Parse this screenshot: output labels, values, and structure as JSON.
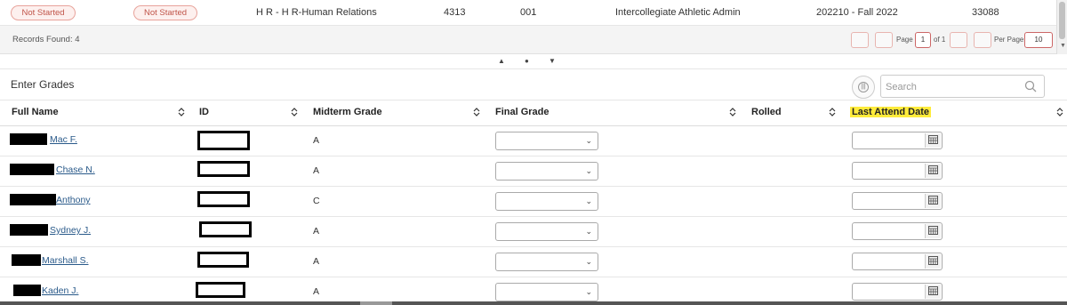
{
  "course_row": {
    "status_a": "Not Started",
    "status_b": "Not Started",
    "subject": "H R - H R-Human Relations",
    "course_number": "4313",
    "section": "001",
    "title": "Intercollegiate Athletic Admin",
    "term": "202210 - Fall 2022",
    "crn": "33088"
  },
  "records": {
    "label": "Records Found: 4",
    "page_label": "Page",
    "page_value": "1",
    "of_label": "of 1",
    "per_page_label": "Per Page",
    "per_page_value": "10"
  },
  "panel": {
    "title": "Enter Grades",
    "search_placeholder": "Search"
  },
  "columns": {
    "full_name": "Full Name",
    "id": "ID",
    "midterm": "Midterm Grade",
    "final": "Final Grade",
    "rolled": "Rolled",
    "last_attend": "Last Attend Date"
  },
  "students": [
    {
      "name": "Mac F.",
      "midterm": "A"
    },
    {
      "name": "Chase N.",
      "midterm": "A"
    },
    {
      "name": "Anthony",
      "midterm": "C"
    },
    {
      "name": "Sydney J.",
      "midterm": "A"
    },
    {
      "name": "Marshall S.",
      "midterm": "A"
    },
    {
      "name": "Kaden J.",
      "midterm": "A"
    }
  ],
  "colors": {
    "status_pill_border": "#e8a39b",
    "status_pill_text": "#c0554a",
    "link": "#2a5a8a",
    "highlight": "#ffeb3b"
  },
  "icons": [
    "search-icon",
    "calendar-icon",
    "sort-icon",
    "chevron-down-icon",
    "columns-icon"
  ]
}
